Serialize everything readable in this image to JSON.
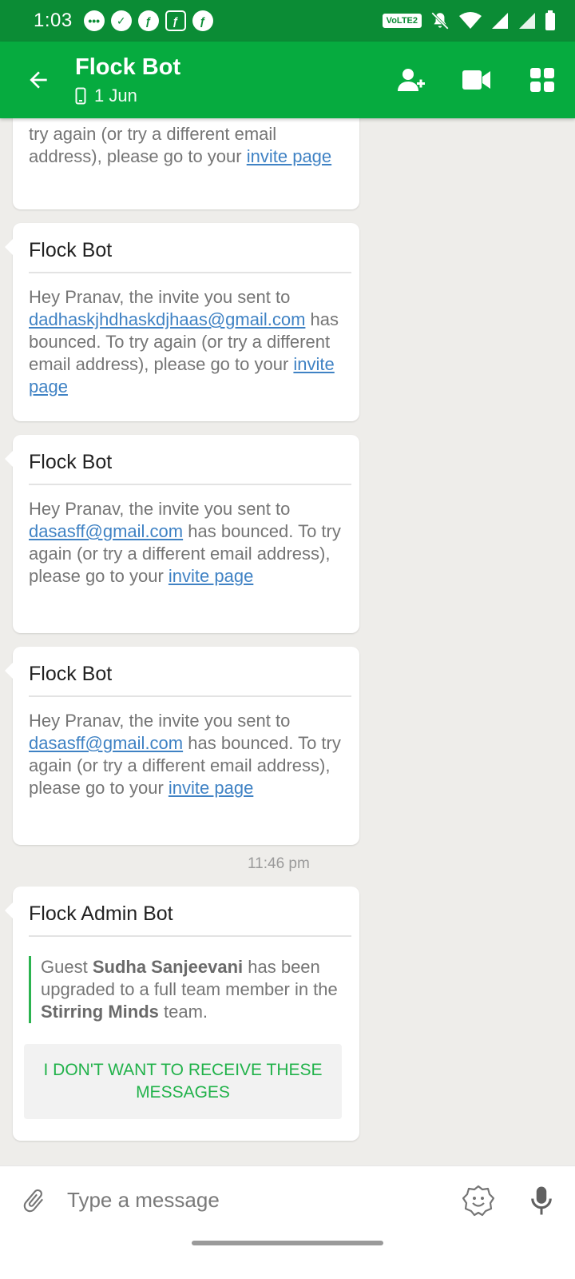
{
  "status": {
    "time": "1:03",
    "volte": "VoLTE2"
  },
  "header": {
    "title": "Flock Bot",
    "subtitle": "1 Jun"
  },
  "messages": [
    {
      "partial_text": "try again (or try a different email address), please go to your",
      "link": "invite page"
    },
    {
      "sender": "Flock Bot",
      "pre": "Hey Pranav, the invite you sent to",
      "email": "dadhaskjhdhaskdjhaas@gmail.com",
      "post": "has bounced. To try again (or try a different email address), please go to your",
      "link": "invite page"
    },
    {
      "sender": "Flock Bot",
      "pre": "Hey Pranav, the invite you sent to",
      "email": "dasasff@gmail.com",
      "post": "has bounced. To try again (or try a different email address), please go to your",
      "link": "invite page"
    },
    {
      "sender": "Flock Bot",
      "pre": "Hey Pranav, the invite you sent to",
      "email": "dasasff@gmail.com",
      "post": "has bounced. To try again (or try a different email address), please go to your",
      "link": "invite page"
    }
  ],
  "timestamp": "11:46 pm",
  "admin_message": {
    "sender": "Flock Admin Bot",
    "t1": "Guest",
    "name": "Sudha Sanjeevani",
    "t2": "has been upgraded to a full team member in the",
    "team": "Stirring Minds",
    "t3": "team.",
    "button": "I DON'T WANT TO RECEIVE THESE MESSAGES"
  },
  "compose": {
    "placeholder": "Type a message"
  },
  "colors": {
    "status_bar": "#0b8c35",
    "app_bar": "#06ab3f",
    "link": "#3f82c4",
    "accent": "#21b24a"
  }
}
